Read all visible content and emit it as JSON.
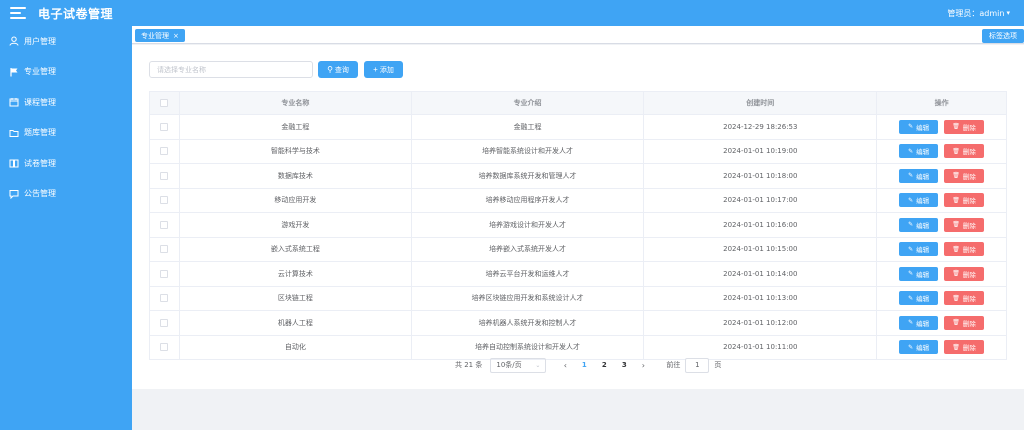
{
  "header": {
    "title": "电子试卷管理",
    "user_label": "管理员：admin",
    "caret": "▾"
  },
  "sidebar": {
    "items": [
      {
        "label": "用户管理",
        "icon": "user-icon"
      },
      {
        "label": "专业管理",
        "icon": "flag-icon"
      },
      {
        "label": "课程管理",
        "icon": "calendar-icon"
      },
      {
        "label": "题库管理",
        "icon": "folder-icon"
      },
      {
        "label": "试卷管理",
        "icon": "book-icon"
      },
      {
        "label": "公告管理",
        "icon": "chat-icon"
      }
    ]
  },
  "tagbar": {
    "active_tag": "专业管理",
    "close_glyph": "×",
    "right_button": "标签选项"
  },
  "search": {
    "placeholder": "请选择专业名称",
    "value": "",
    "query_label": "查询",
    "add_label": "添加"
  },
  "table": {
    "columns": [
      "专业名称",
      "专业介绍",
      "创建时间",
      "操作"
    ],
    "edit_label": "编辑",
    "delete_label": "删除",
    "rows": [
      {
        "name": "金融工程",
        "intro": "金融工程",
        "created": "2024-12-29 18:26:53"
      },
      {
        "name": "智能科学与技术",
        "intro": "培养智能系统设计和开发人才",
        "created": "2024-01-01 10:19:00"
      },
      {
        "name": "数据库技术",
        "intro": "培养数据库系统开发和管理人才",
        "created": "2024-01-01 10:18:00"
      },
      {
        "name": "移动应用开发",
        "intro": "培养移动应用程序开发人才",
        "created": "2024-01-01 10:17:00"
      },
      {
        "name": "游戏开发",
        "intro": "培养游戏设计和开发人才",
        "created": "2024-01-01 10:16:00"
      },
      {
        "name": "嵌入式系统工程",
        "intro": "培养嵌入式系统开发人才",
        "created": "2024-01-01 10:15:00"
      },
      {
        "name": "云计算技术",
        "intro": "培养云平台开发和运维人才",
        "created": "2024-01-01 10:14:00"
      },
      {
        "name": "区块链工程",
        "intro": "培养区块链应用开发和系统设计人才",
        "created": "2024-01-01 10:13:00"
      },
      {
        "name": "机器人工程",
        "intro": "培养机器人系统开发和控制人才",
        "created": "2024-01-01 10:12:00"
      },
      {
        "name": "自动化",
        "intro": "培养自动控制系统设计和开发人才",
        "created": "2024-01-01 10:11:00"
      }
    ]
  },
  "pagination": {
    "total": "共 21 条",
    "page_size": "10条/页",
    "pages": [
      "1",
      "2",
      "3"
    ],
    "current_page": "1",
    "prev_glyph": "‹",
    "next_glyph": "›",
    "goto_label": "前往",
    "goto_value": "1",
    "goto_suffix": "页"
  },
  "colors": {
    "primary": "#3fa4f4",
    "danger": "#f56c6c",
    "background": "#f0f2f5"
  }
}
